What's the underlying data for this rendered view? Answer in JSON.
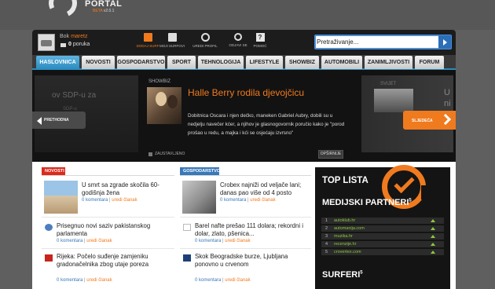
{
  "brand": {
    "name": "PORTAL",
    "beta": "BETA",
    "version": "v2.0.1"
  },
  "user": {
    "greeting": "Bok",
    "username": "maretz",
    "messages_count": "0",
    "messages_label": "poruka"
  },
  "toolbar": [
    {
      "icon": "home-icon",
      "label": "DODAJ SURF"
    },
    {
      "icon": "folder-icon",
      "label": "MOJI SURFOVI"
    },
    {
      "icon": "profile-icon",
      "label": "UREDI PROFIL"
    },
    {
      "icon": "power-icon",
      "label": "ODJAVI SE"
    },
    {
      "icon": "help-icon",
      "label": "POMOĆ"
    }
  ],
  "search": {
    "placeholder": "Pretraživanje...",
    "value": "Pretraživanje..."
  },
  "nav": {
    "tabs": [
      "HASLOVNICA",
      "NOVOSTI",
      "GOSPODARSTVO",
      "SPORT",
      "TEHNOLOGIJA",
      "LIFESTYLE",
      "SHOWBIZ",
      "AUTOMOBILI",
      "ZANIMLJIVOSTI",
      "FORUM"
    ],
    "active": "HASLOVNICA"
  },
  "slider": {
    "prev_title": "ov SDP-u za",
    "prev_sub": "SDP-u",
    "prev_label": "PRETHODNA",
    "next_cat": "SVIJET",
    "next_title_1": "U",
    "next_title_2": "ni",
    "next_label": "SLJEDEĆA",
    "current": {
      "category": "SHOWBIZ",
      "title": "Halle Berry rodila djevojčicu",
      "body": "Dobitnica Oscara i njen dečko, maneken Gabriel Aubry, dobili su u nedjelju navečer kćer, a njihov je glasnogovornik poručio kako je \"porod prošao u redu, a majka i kći se osjećaju izvrsno\"",
      "pause_label": "ZAUSTAVLJENO",
      "more_label": "OPŠIRNIJE"
    }
  },
  "columns": {
    "left": {
      "label": "NOVOSTI",
      "articles": [
        {
          "title": "U smrt sa zgrade skočila 60-godišnja žena",
          "comments": "0 komentara",
          "edit": "uredi članak"
        },
        {
          "title": "Prisegnuo novi saziv pakistanskog parlamenta",
          "comments": "0 komentara",
          "edit": "uredi članak"
        },
        {
          "title": "Rijeka: Počelo suđenje zamjeniku gradonačelnika zbog utaje poreza",
          "comments": "0 komentara",
          "edit": "uredi članak"
        }
      ]
    },
    "right": {
      "label": "GOSPODARSTVO",
      "articles": [
        {
          "title": "Crobex najniži od veljače lani; danas pao više od 4 posto",
          "comments": "0 komentara",
          "edit": "uredi članak"
        },
        {
          "title": "Barel nafte prešao 111 dolara; rekordni i dolar, zlato, pšenica...",
          "comments": "0 komentara",
          "edit": "uredi članak"
        },
        {
          "title": "Skok Beogradske burze, Ljubljana ponovno u crvenom",
          "comments": "0 komentara",
          "edit": "uredi članak"
        }
      ]
    }
  },
  "top_lista": {
    "title": "TOP LISTA",
    "partners_title": "MEDIJSKI PARTNERI",
    "partners_sup": "5",
    "partners": [
      {
        "num": "1",
        "name": "autoklub.hr"
      },
      {
        "num": "2",
        "name": "automanija.com"
      },
      {
        "num": "3",
        "name": "muzika.hr"
      },
      {
        "num": "4",
        "name": "recenzije.hr"
      },
      {
        "num": "5",
        "name": "crovertex.com"
      }
    ],
    "surferi_title": "SURFERI",
    "surferi_sup": "5"
  },
  "colors": {
    "accent": "#f07a1e",
    "nav_active": "#2a8cc0",
    "novosti": "#d92b1e",
    "gospodarstvo": "#3a78b8"
  }
}
